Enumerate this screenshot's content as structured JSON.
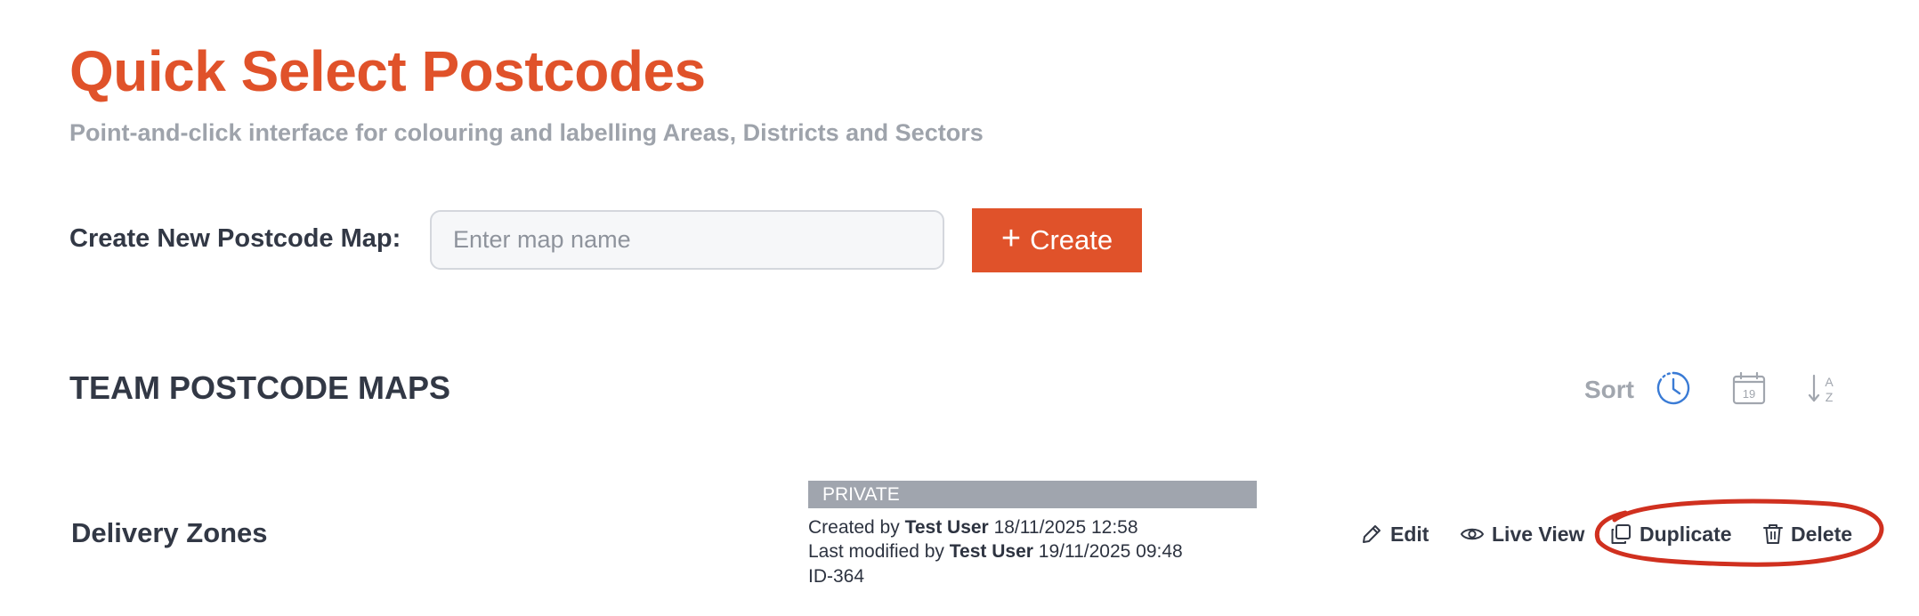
{
  "header": {
    "title": "Quick Select Postcodes",
    "subtitle": "Point-and-click interface for colouring and labelling Areas, Districts and Sectors"
  },
  "create": {
    "label": "Create New Postcode Map:",
    "input_value": "",
    "input_placeholder": "Enter map name",
    "button_label": "Create",
    "button_icon": "plus-icon"
  },
  "section": {
    "title": "TEAM POSTCODE MAPS",
    "sort_label": "Sort",
    "sort_options": [
      {
        "icon": "clock-icon",
        "active": true
      },
      {
        "icon": "calendar-icon",
        "text": "19",
        "active": false
      },
      {
        "icon": "sort-az-icon",
        "text_a": "A",
        "text_z": "Z",
        "active": false
      }
    ]
  },
  "maps": [
    {
      "name": "Delivery Zones",
      "visibility": "PRIVATE",
      "created_prefix": "Created by",
      "created_by": "Test User",
      "created_at": "18/11/2025 12:58",
      "modified_prefix": "Last modified by",
      "modified_by": "Test User",
      "modified_at": "19/11/2025 09:48",
      "id": "ID-364",
      "actions": [
        {
          "label": "Edit",
          "icon": "pencil-icon"
        },
        {
          "label": "Live View",
          "icon": "eye-icon"
        },
        {
          "label": "Duplicate",
          "icon": "copy-icon"
        },
        {
          "label": "Delete",
          "icon": "trash-icon"
        }
      ]
    }
  ],
  "colors": {
    "brand": "#e0522a",
    "heading": "#323845",
    "muted": "#9ea3ab",
    "badge": "#a0a5ae",
    "sort_active": "#3a7bd5",
    "annotation": "#d0301f"
  }
}
